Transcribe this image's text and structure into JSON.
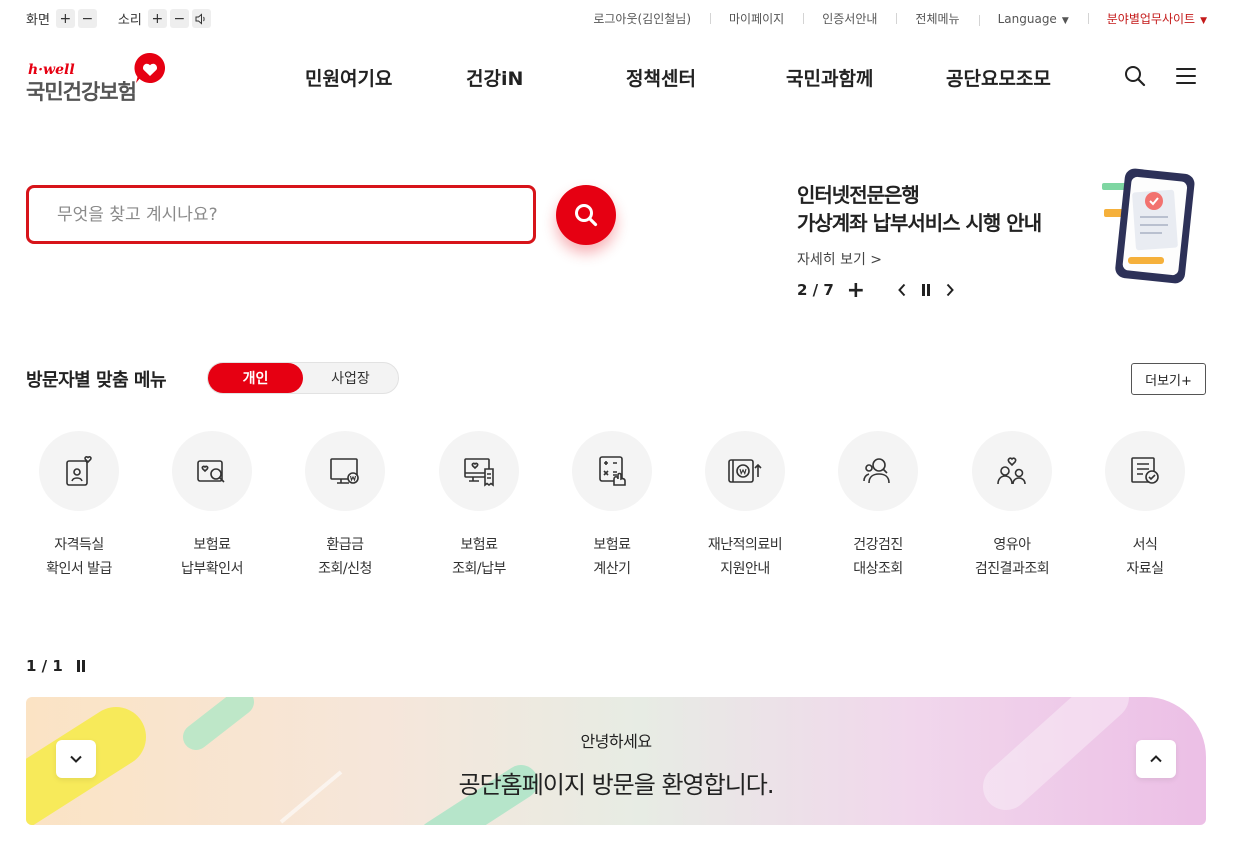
{
  "util_bar": {
    "screen_label": "화면",
    "sound_label": "소리",
    "plus": "+",
    "minus": "−",
    "links": [
      "로그아웃(김인철님)",
      "마이페이지",
      "인증서안내",
      "전체메뉴"
    ],
    "language": "Language",
    "field_sites": "분야별업무사이트"
  },
  "logo": {
    "small": "h·well",
    "main": "국민건강보험"
  },
  "gnb": [
    "민원여기요",
    "건강iN",
    "정책센터",
    "국민과함께",
    "공단요모조모"
  ],
  "search": {
    "placeholder": "무엇을 찾고 계시나요?"
  },
  "banner": {
    "title_line1": "인터넷전문은행",
    "title_line2": "가상계좌 납부서비스 시행 안내",
    "link": "자세히 보기 >",
    "pager": "2 / 7",
    "plus": "+"
  },
  "section": {
    "title": "방문자별 맞춤 메뉴",
    "tab_personal": "개인",
    "tab_business": "사업장",
    "more": "더보기+"
  },
  "quick_menu": [
    {
      "label": "자격득실\n확인서 발급",
      "icon": "id-card-heart-icon"
    },
    {
      "label": "보험료\n납부확인서",
      "icon": "document-search-icon"
    },
    {
      "label": "환급금\n조회/신청",
      "icon": "monitor-won-icon"
    },
    {
      "label": "보험료\n조회/납부",
      "icon": "monitor-receipt-icon"
    },
    {
      "label": "보험료\n계산기",
      "icon": "calculator-icon"
    },
    {
      "label": "재난적의료비\n지원안내",
      "icon": "wallet-won-icon"
    },
    {
      "label": "건강검진\n대상조회",
      "icon": "people-search-icon"
    },
    {
      "label": "영유아\n검진결과조회",
      "icon": "family-heart-icon"
    },
    {
      "label": "서식\n자료실",
      "icon": "form-check-icon"
    }
  ],
  "quick_pager": "1 / 1",
  "welcome": {
    "small": "안녕하세요",
    "big": "공단홈페이지 방문을 환영합니다."
  },
  "colors": {
    "brand_red": "#e60012",
    "search_border": "#d7141a"
  }
}
